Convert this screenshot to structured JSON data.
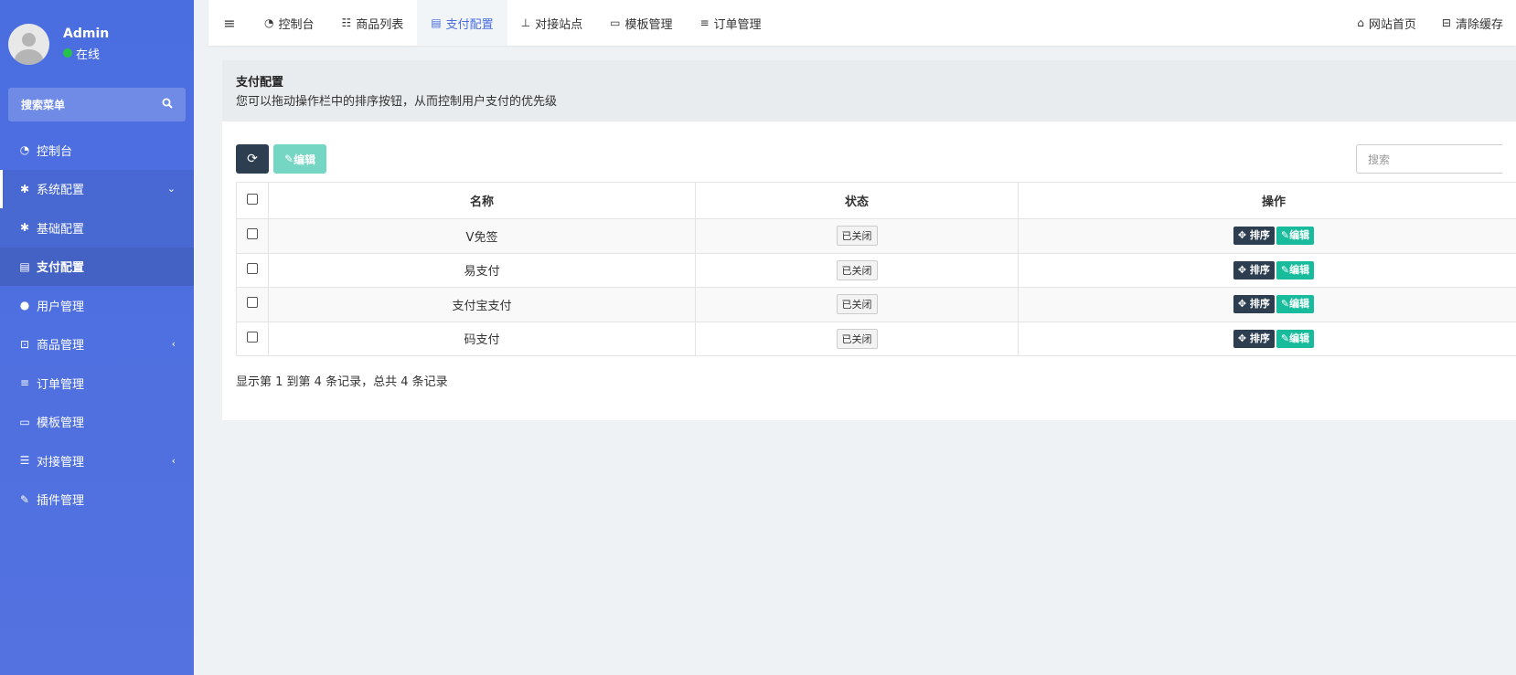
{
  "user": {
    "name": "Admin",
    "status": "在线"
  },
  "sidebar": {
    "search_placeholder": "搜索菜单",
    "items": [
      {
        "label": "控制台",
        "icon": "dashboard-icon"
      },
      {
        "label": "系统配置",
        "icon": "gear-icon"
      },
      {
        "label": "基础配置",
        "icon": "gear-icon"
      },
      {
        "label": "支付配置",
        "icon": "server-icon"
      },
      {
        "label": "用户管理",
        "icon": "user-icon"
      },
      {
        "label": "商品管理",
        "icon": "cart-icon"
      },
      {
        "label": "订单管理",
        "icon": "list-icon"
      },
      {
        "label": "模板管理",
        "icon": "template-icon"
      },
      {
        "label": "对接管理",
        "icon": "sliders-icon"
      },
      {
        "label": "插件管理",
        "icon": "plug-icon"
      }
    ]
  },
  "topnav": {
    "tabs": [
      {
        "label": "控制台",
        "icon": "dashboard-icon"
      },
      {
        "label": "商品列表",
        "icon": "list-icon"
      },
      {
        "label": "支付配置",
        "icon": "server-icon"
      },
      {
        "label": "对接站点",
        "icon": "sitemap-icon"
      },
      {
        "label": "模板管理",
        "icon": "template-icon"
      },
      {
        "label": "订单管理",
        "icon": "list-icon"
      }
    ],
    "right": [
      {
        "label": "网站首页",
        "icon": "home-icon"
      },
      {
        "label": "清除缓存",
        "icon": "trash-icon"
      }
    ]
  },
  "page": {
    "title": "支付配置",
    "description": "您可以拖动操作栏中的排序按钮，从而控制用户支付的优先级"
  },
  "toolbar": {
    "edit_label": "编辑",
    "search_placeholder": "搜索"
  },
  "table": {
    "headers": [
      "名称",
      "状态",
      "操作"
    ],
    "rows": [
      {
        "name": "V免签",
        "status": "已关闭"
      },
      {
        "name": "易支付",
        "status": "已关闭"
      },
      {
        "name": "支付宝支付",
        "status": "已关闭"
      },
      {
        "name": "码支付",
        "status": "已关闭"
      }
    ],
    "sort_label": "排序",
    "edit_label": "编辑"
  },
  "pagination": {
    "info": "显示第 1 到第 4 条记录，总共 4 条记录"
  },
  "colors": {
    "sidebar": "#4a6de0",
    "primary_dark": "#2c3e50",
    "success": "#18bc9c",
    "online": "#27c24c"
  }
}
